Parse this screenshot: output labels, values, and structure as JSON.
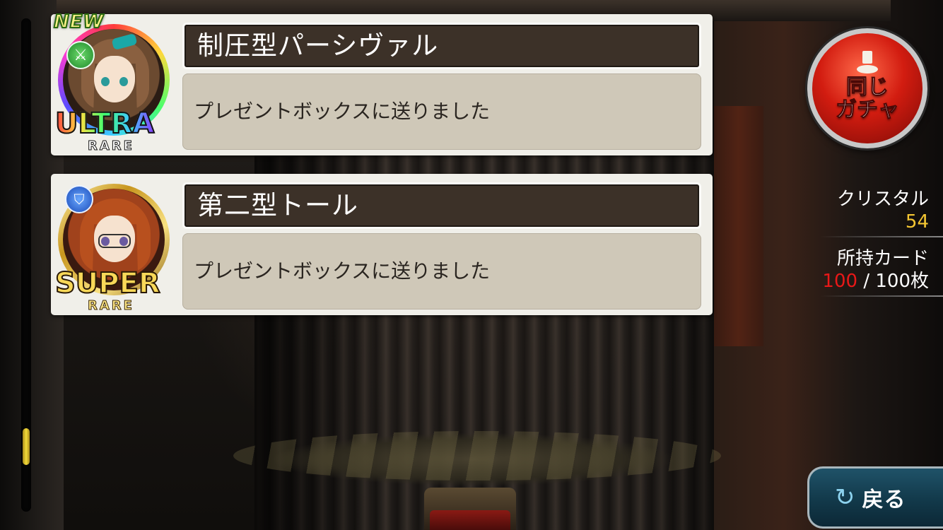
{
  "results": [
    {
      "name": "制圧型パーシヴァル",
      "message": "プレゼントボックスに送りました",
      "is_new": true,
      "new_label": "NEW",
      "rarity_main": "ULTRA",
      "rarity_sub": "RARE",
      "type_icon": "sword-icon"
    },
    {
      "name": "第二型トール",
      "message": "プレゼントボックスに送りました",
      "is_new": false,
      "rarity_main": "SUPER",
      "rarity_sub": "RARE",
      "type_icon": "shield-icon"
    }
  ],
  "gacha_button": {
    "label": "同じ\nガチャ",
    "icon": "lever-icon"
  },
  "stats": {
    "crystal_label": "クリスタル",
    "crystal_value": "54",
    "cards_label": "所持カード",
    "cards_owned": "100",
    "cards_separator": " / ",
    "cards_max": "100枚"
  },
  "back_button": {
    "label": "戻る",
    "icon": "return-arrow-icon"
  },
  "colors": {
    "crystal_value": "#f4c632",
    "cards_owned": "#e81818",
    "gacha_button": "#d21c10",
    "back_button": "#1f5268"
  }
}
